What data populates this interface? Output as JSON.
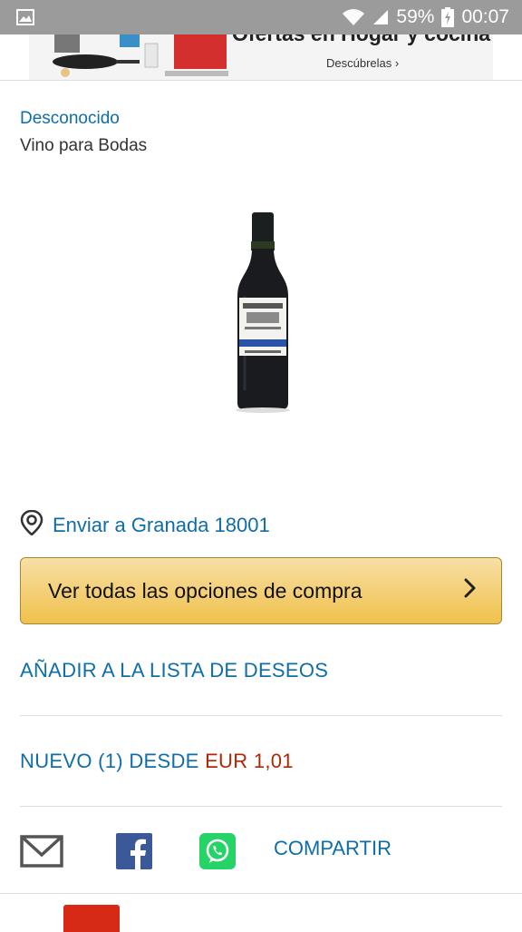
{
  "status_bar": {
    "battery_percent": "59%",
    "time": "00:07",
    "icons": [
      "image-notification-icon",
      "wifi-icon",
      "signal-icon",
      "battery-charging-icon"
    ]
  },
  "banner": {
    "title": "Ofertas en Hogar y cocina",
    "cta": "Descúbrelas ›"
  },
  "product": {
    "brand": "Desconocido",
    "title": "Vino para Bodas"
  },
  "delivery": {
    "label": "Enviar a Granada 18001",
    "icon": "location-pin-icon"
  },
  "buy_button": {
    "label": "Ver todas las opciones de compra",
    "icon": "chevron-right-icon"
  },
  "wishlist": {
    "label": "AÑADIR A LA LISTA DE DESEOS"
  },
  "offers": {
    "label": "NUEVO (1) DESDE ",
    "price": "EUR 1,01"
  },
  "share": {
    "label": "COMPARTIR",
    "icons": [
      "email-icon",
      "facebook-icon",
      "whatsapp-icon"
    ]
  },
  "colors": {
    "link": "#0f6da8",
    "price": "#b12704",
    "button_top": "#f7dfa5",
    "button_bottom": "#f0c14b",
    "facebook": "#3b5998",
    "whatsapp": "#25d366",
    "status_bar": "#9b9b9b"
  }
}
